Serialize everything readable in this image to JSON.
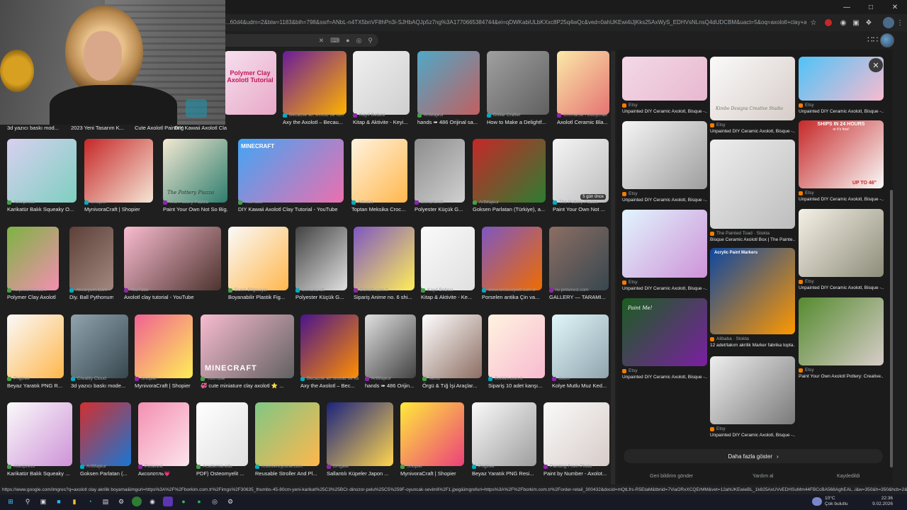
{
  "browser": {
    "url": "...60d4&udm=2&biw=1183&bih=798&ssrf=ANbL-n4TX5bnVF8hPn3i-SJHbAQJp5z7ng%3A1770665384744&ei=qDWKabiULbKXxc8P25q4wQc&ved=0ahUKEwi4iJjKks25AxWyS_EDHVsNLnsQ4dUDCBM&uact=5&oq=axolotl+clay+akrilik+boyama&gs_lp=Egtnd3Mt...",
    "status_url": "https://www.google.com/imgres?q=axolotl clay akrilik boyama&imgurl=https%3A%2F%2Fborkim.com.tr%2Fimgs%2F30635_thumbs-45-80cm-yeni-karikat%25C3%25BCr-dinozor-pelu%25C5%259F-oyuncak-sevimli%2F1.jpeg&imgrefurl=https%3A%2F%2Fborkim.com.tr%2Forder-retail_300432&docid=mQtLfrs-R5EtaM&tbnid=7ViaORxXCQErMM&vet=12ahUKEwieBL_1k825AxUVvEDHSuMm44FBCcBA568AghEAL..i&w=350&h=350&hcb=2&ved=2ahUKEwieBL_1k825AxU..."
  },
  "grid": {
    "row0": [
      {
        "title": "3d yazıcı baskı mod...",
        "source": ""
      },
      {
        "title": "2023 Yeni Tasarım K...",
        "source": ""
      },
      {
        "title": "Cute Axolotl Painting",
        "source": ""
      },
      {
        "title": "DIY Kawaii Axolotl Clay Tutorial -...",
        "source": ""
      },
      {
        "title": "Axy the Axolotl – Becau...",
        "source": "Because art should be fun!"
      },
      {
        "title": "Kitap & Aktivite - Keyi...",
        "source": "Kayıf Bebesi"
      },
      {
        "title": "hands ➠ 486 Orijinal sa...",
        "source": "ArtMajeur"
      },
      {
        "title": "How to Make a Delightf...",
        "source": "Dollar Crafter"
      },
      {
        "title": "Axolotl Ceramic Bla...",
        "source": "Cromartie Hobbycraft"
      }
    ],
    "row1": [
      {
        "title": "Karikatür Balık Squeaky O...",
        "source": "Aliexpress"
      },
      {
        "title": "MynivoraCraft | Shopier",
        "source": "Shopier"
      },
      {
        "title": "Paint Your Own Not So Big...",
        "source": "The Pottery Piazza"
      },
      {
        "title": "DIY Kawaii Axolotl Clay Tutorial - YouTube",
        "source": "YouTube",
        "badge": "MINECRAFT"
      },
      {
        "title": "Toptan Meksika Croc...",
        "source": "Alibaba"
      },
      {
        "title": "Polyester Küçük G...",
        "source": "Benartcraft"
      },
      {
        "title": "Goksen Parlatan (Türkiye), a...",
        "source": "ArtMajeur"
      },
      {
        "title": "Paint Your Own Not ...",
        "source": "The Pottery Piazza",
        "badge": "5 gün önce"
      }
    ],
    "row2": [
      {
        "title": "Polymer Clay Axolotl",
        "source": "ru.pinterest.com"
      },
      {
        "title": "Diy. Ball Pythonum ...",
        "source": "Akvaryum.Com"
      },
      {
        "title": "Axolotl clay tutorial - YouTube",
        "source": "YouTube"
      },
      {
        "title": "Boyanabilir Plastik Fig...",
        "source": "Ecem Bilgisayar"
      },
      {
        "title": "Polyester Küçük G...",
        "source": "Benartcraft"
      },
      {
        "title": "Sipariş Anime no. 6 shi...",
        "source": "Borkim.com.tr"
      },
      {
        "title": "Kitap & Aktivite - Ke...",
        "source": "Kayıf Bebesi"
      },
      {
        "title": "Porselen antika Çin va...",
        "source": "www.lenicsepelli.com.tr"
      },
      {
        "title": "GALLERY — TARAMI...",
        "source": "ru.pinterest.com"
      }
    ],
    "row3": [
      {
        "title": "Beyaz Yaratık PNG R...",
        "source": "Pngtree"
      },
      {
        "title": "3d yazıcı baskı mode...",
        "source": "Creality Cloud"
      },
      {
        "title": "MynivoraCraft | Shopier",
        "source": "Shopier"
      },
      {
        "title": "💞 cute miniature clay axolotl ⭐ ...",
        "source": "YouTube",
        "badge": "MINECRAF"
      },
      {
        "title": "Axy the Axolotl – Bec...",
        "source": "Because art should be fun!"
      },
      {
        "title": "hands ➠ 486 Orijin...",
        "source": "ArtMajeur"
      },
      {
        "title": "Örgü & Tığ İşi Araçlar...",
        "source": "Temu"
      },
      {
        "title": "Sipariş 10 adet kanşı...",
        "source": "Borkim.com.tr"
      },
      {
        "title": "Kolye Mutlu Muz Ked...",
        "source": "Joom"
      }
    ],
    "row4": [
      {
        "title": "Karikatür Balık Squeaky ...",
        "source": "Aliexpress"
      },
      {
        "title": "Goksen Parlatan (...",
        "source": "ArtMajeur"
      },
      {
        "title": "Аксолотль💗",
        "source": "Pinterest"
      },
      {
        "title": "PDF) Osteomyelit ...",
        "source": "Academia.edu"
      },
      {
        "title": "Reusable Stroller And Pl...",
        "source": "Insolvencyforte.com"
      },
      {
        "title": "Sallantılı Küpeler Japon ...",
        "source": "DHgate"
      },
      {
        "title": "MynivoraCraft | Shopier",
        "source": "Shopier"
      },
      {
        "title": "Beyaz Yaratık PNG Resi...",
        "source": "Pngtree"
      },
      {
        "title": "Paint by Number - Axolot...",
        "source": "Painting From Photo"
      }
    ]
  },
  "panel": {
    "items": [
      {
        "source": "Etsy",
        "title": "Unpainted DIY Ceramic Axolotl, Bisque -..."
      },
      {
        "source": "Etsy",
        "title": "Unpainted DIY Ceramic Axolotl, Bisque -..."
      },
      {
        "source": "Etsy",
        "title": "Unpainted DIY Ceramic Axolotl, Bisque -..."
      },
      {
        "source": "Etsy",
        "title": "Unpainted DIY Ceramic Axolotl, Bisque -..."
      },
      {
        "source": "The Painted Toad · Stokta",
        "title": "Bisque Ceramic Axolotl Box | The Painte..."
      },
      {
        "source": "Etsy",
        "title": "Unpainted DIY Ceramic Axolotl, Bisque -..."
      },
      {
        "source": "Etsy",
        "title": "Unpainted DIY Ceramic Axolotl, Bisque -..."
      },
      {
        "source": "Alibaba · Stokta",
        "title": "12 adet/takım akrilik Marker fabrika topta..."
      },
      {
        "source": "Etsy",
        "title": "Unpainted DIY Ceramic Axolotl, Bisque -..."
      },
      {
        "source": "Etsy",
        "title": "Unpainted DIY Ceramic Axolotl, Bisque -..."
      },
      {
        "source": "Etsy",
        "title": "Unpainted DIY Ceramic Axolotl, Bisque -..."
      },
      {
        "source": "Etsy",
        "title": "Paint Your Own Axolotl Pottery: Creative..."
      },
      {
        "source": "Etsy",
        "title": "Unpainted DIY Ceramic Axolotl, Bisque -..."
      }
    ],
    "ad_text": "SHIPS IN 24 HOURS",
    "ad_sub": "or it's free!",
    "ad_upto": "UP TO 46\"",
    "studio_text": "Kimbo Designs Creative Studio",
    "more_label": "Daha fazla göster",
    "footer": {
      "feedback": "Geri bildirim gönder",
      "help": "Yardım al",
      "saved": "Kaydedildi"
    }
  },
  "thumb_texts": {
    "polymer": "Polymer Clay Axolotl Tutorial",
    "pottery": "The Pottery Piazza",
    "minecraft": "MINECRAFT",
    "paint_sign": "Paint Me!",
    "markers": "Acrylic Paint Markers"
  },
  "taskbar": {
    "weather_temp": "10°C",
    "weather_desc": "Çok bulutlu",
    "time": "22:36",
    "date": "9.02.2026"
  }
}
